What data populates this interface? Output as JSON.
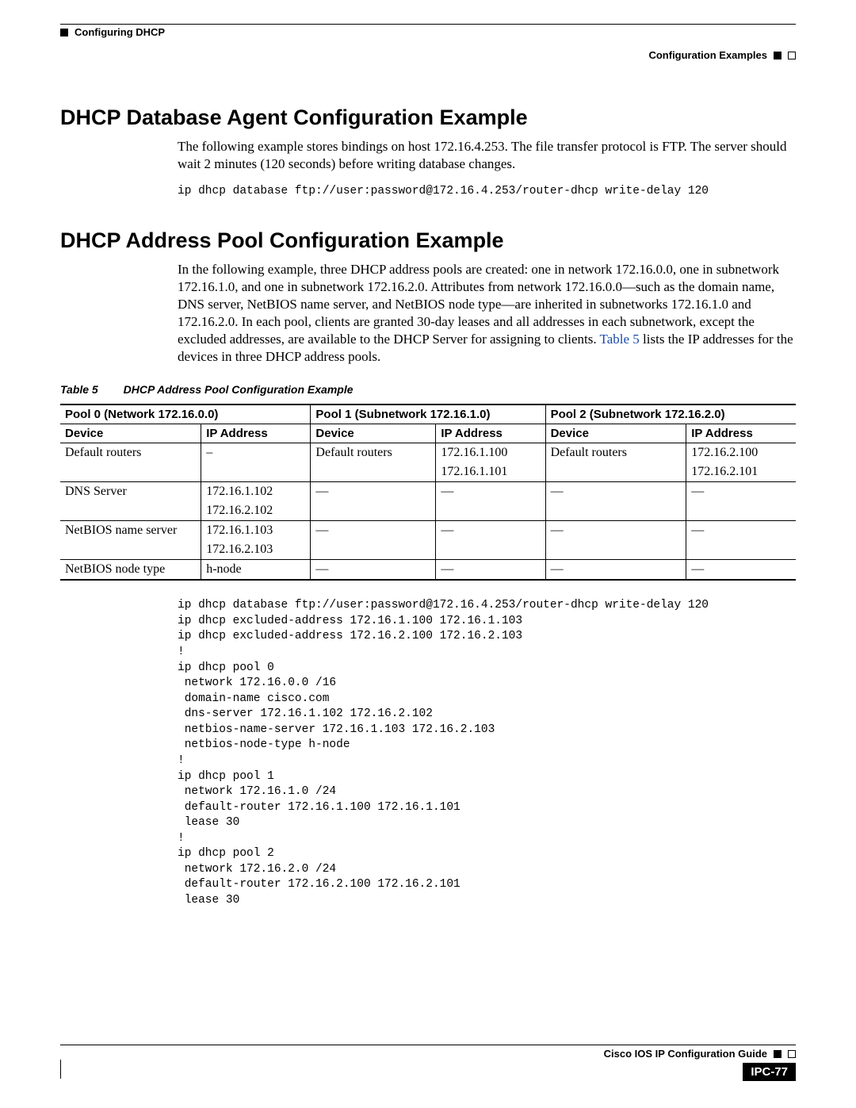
{
  "header": {
    "chapter": "Configuring DHCP",
    "section": "Configuration Examples"
  },
  "s1": {
    "title": "DHCP Database Agent Configuration Example",
    "para": "The following example stores bindings on host 172.16.4.253. The file transfer protocol is FTP. The server should wait 2 minutes (120 seconds) before writing database changes.",
    "code": "ip dhcp database ftp://user:password@172.16.4.253/router-dhcp write-delay 120"
  },
  "s2": {
    "title": "DHCP Address Pool Configuration Example",
    "para_a": "In the following example, three DHCP address pools are created: one in network 172.16.0.0, one in subnetwork 172.16.1.0, and one in subnetwork 172.16.2.0. Attributes from network 172.16.0.0—such as the domain name, DNS server, NetBIOS name server, and NetBIOS node type—are inherited in subnetworks 172.16.1.0 and 172.16.2.0. In each pool, clients are granted 30-day leases and all addresses in each subnetwork, except the excluded addresses, are available to the DHCP Server for assigning to clients. ",
    "para_link": "Table 5",
    "para_b": " lists the IP addresses for the devices in three DHCP address pools."
  },
  "table": {
    "label": "Table 5",
    "title": "DHCP Address Pool Configuration Example",
    "group_headers": [
      "Pool 0 (Network 172.16.0.0)",
      "Pool 1 (Subnetwork 172.16.1.0)",
      "Pool 2 (Subnetwork 172.16.2.0)"
    ],
    "sub_headers": [
      "Device",
      "IP Address",
      "Device",
      "IP Address",
      "Device",
      "IP Address"
    ],
    "rows": [
      [
        "Default routers",
        "–",
        "Default routers",
        "172.16.1.100",
        "Default routers",
        "172.16.2.100"
      ],
      [
        "",
        "",
        "",
        "172.16.1.101",
        "",
        "172.16.2.101"
      ],
      [
        "DNS Server",
        "172.16.1.102",
        "—",
        "—",
        "—",
        "—"
      ],
      [
        "",
        "172.16.2.102",
        "",
        "",
        "",
        ""
      ],
      [
        "NetBIOS name server",
        "172.16.1.103",
        "—",
        "—",
        "—",
        "—"
      ],
      [
        "",
        "172.16.2.103",
        "",
        "",
        "",
        ""
      ],
      [
        "NetBIOS node type",
        "h-node",
        "—",
        "—",
        "—",
        "—"
      ]
    ]
  },
  "code2": "ip dhcp database ftp://user:password@172.16.4.253/router-dhcp write-delay 120\nip dhcp excluded-address 172.16.1.100 172.16.1.103\nip dhcp excluded-address 172.16.2.100 172.16.2.103\n!\nip dhcp pool 0\n network 172.16.0.0 /16\n domain-name cisco.com\n dns-server 172.16.1.102 172.16.2.102\n netbios-name-server 172.16.1.103 172.16.2.103\n netbios-node-type h-node\n!\nip dhcp pool 1\n network 172.16.1.0 /24\n default-router 172.16.1.100 172.16.1.101\n lease 30\n!\nip dhcp pool 2\n network 172.16.2.0 /24\n default-router 172.16.2.100 172.16.2.101\n lease 30",
  "footer": {
    "guide": "Cisco IOS IP Configuration Guide",
    "page": "IPC-77"
  }
}
